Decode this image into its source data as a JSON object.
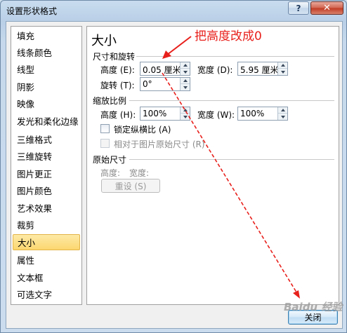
{
  "window": {
    "title": "设置形状格式",
    "help_label": "?",
    "close_label": "✕"
  },
  "sidebar": {
    "items": [
      {
        "label": "填充"
      },
      {
        "label": "线条颜色"
      },
      {
        "label": "线型"
      },
      {
        "label": "阴影"
      },
      {
        "label": "映像"
      },
      {
        "label": "发光和柔化边缘"
      },
      {
        "label": "三维格式"
      },
      {
        "label": "三维旋转"
      },
      {
        "label": "图片更正"
      },
      {
        "label": "图片颜色"
      },
      {
        "label": "艺术效果"
      },
      {
        "label": "裁剪"
      },
      {
        "label": "大小",
        "selected": true
      },
      {
        "label": "属性"
      },
      {
        "label": "文本框"
      },
      {
        "label": "可选文字"
      }
    ]
  },
  "panel": {
    "heading": "大小",
    "size_rotate": {
      "section": "尺寸和旋转",
      "height_label": "高度 (E):",
      "height_value": "0.05 厘米",
      "width_label": "宽度 (D):",
      "width_value": "5.95 厘米",
      "rotate_label": "旋转 (T):",
      "rotate_value": "0°"
    },
    "scale": {
      "section": "缩放比例",
      "height_label": "高度 (H):",
      "height_value": "100%",
      "width_label": "宽度 (W):",
      "width_value": "100%",
      "lock_aspect_label": "锁定纵横比 (A)",
      "relative_label": "相对于图片原始尺寸 (R)"
    },
    "original": {
      "section": "原始尺寸",
      "height_label": "高度:",
      "width_label": "宽度:",
      "reset_label": "重设 (S)"
    }
  },
  "footer": {
    "close_label": "关闭"
  },
  "annotation": {
    "text": "把高度改成0",
    "color": "#e8201c"
  },
  "watermark": {
    "text": "Baidu 经验"
  }
}
